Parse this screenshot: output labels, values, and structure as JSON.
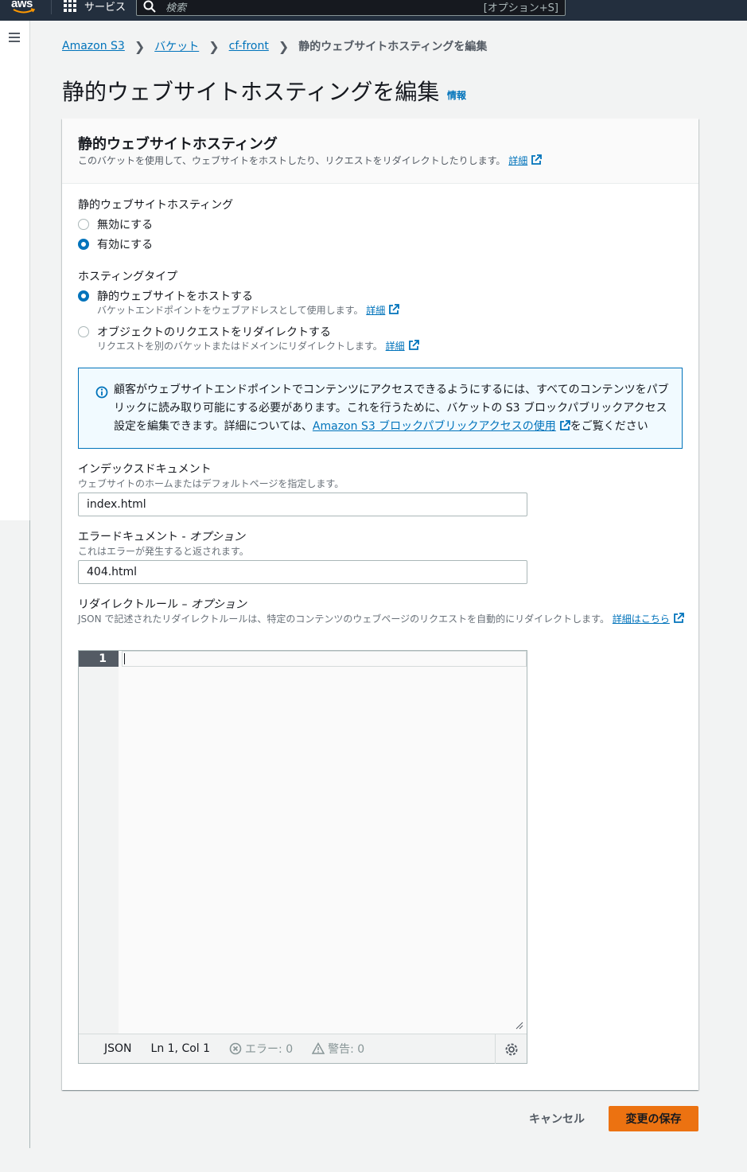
{
  "topnav": {
    "logo": "aws",
    "services_label": "サービス",
    "search_placeholder": "検索",
    "search_shortcut": "[オプション+S]"
  },
  "breadcrumb": {
    "items": [
      "Amazon S3",
      "バケット",
      "cf-front"
    ],
    "current": "静的ウェブサイトホスティングを編集"
  },
  "page": {
    "title": "静的ウェブサイトホスティングを編集",
    "info_label": "情報"
  },
  "panel": {
    "title": "静的ウェブサイトホスティング",
    "description": "このバケットを使用して、ウェブサイトをホストしたり、リクエストをリダイレクトしたりします。",
    "details_link": "詳細"
  },
  "hosting": {
    "label": "静的ウェブサイトホスティング",
    "options": [
      "無効にする",
      "有効にする"
    ],
    "selected": "有効にする"
  },
  "hosting_type": {
    "label": "ホスティングタイプ",
    "options": [
      {
        "label": "静的ウェブサイトをホストする",
        "desc": "バケットエンドポイントをウェブアドレスとして使用します。",
        "link": "詳細"
      },
      {
        "label": "オブジェクトのリクエストをリダイレクトする",
        "desc": "リクエストを別のバケットまたはドメインにリダイレクトします。",
        "link": "詳細"
      }
    ],
    "selected": "静的ウェブサイトをホストする"
  },
  "alert": {
    "text_before": "顧客がウェブサイトエンドポイントでコンテンツにアクセスできるようにするには、すべてのコンテンツをパブリックに読み取り可能にする必要があります。これを行うために、バケットの S3 ブロックパブリックアクセス設定を編集できます。詳細については、",
    "link": "Amazon S3 ブロックパブリックアクセスの使用",
    "text_after": "をご覧ください"
  },
  "index_document": {
    "label": "インデックスドキュメント",
    "desc": "ウェブサイトのホームまたはデフォルトページを指定します。",
    "value": "index.html"
  },
  "error_document": {
    "label": "エラードキュメント - ",
    "label_optional": "オプション",
    "desc": "これはエラーが発生すると返されます。",
    "value": "404.html"
  },
  "redirect_rules": {
    "label": "リダイレクトルール – ",
    "label_optional": "オプション",
    "desc": "JSON で記述されたリダイレクトルールは、特定のコンテンツのウェブページのリクエストを自動的にリダイレクトします。",
    "link": "詳細はこちら"
  },
  "editor": {
    "line_number": "1",
    "language": "JSON",
    "position": "Ln 1, Col 1",
    "errors": "エラー: 0",
    "warnings": "警告: 0"
  },
  "actions": {
    "cancel": "キャンセル",
    "save": "変更の保存"
  },
  "colors": {
    "primary": "#ec7211",
    "link": "#0073bb",
    "nav_bg": "#232f3e"
  }
}
